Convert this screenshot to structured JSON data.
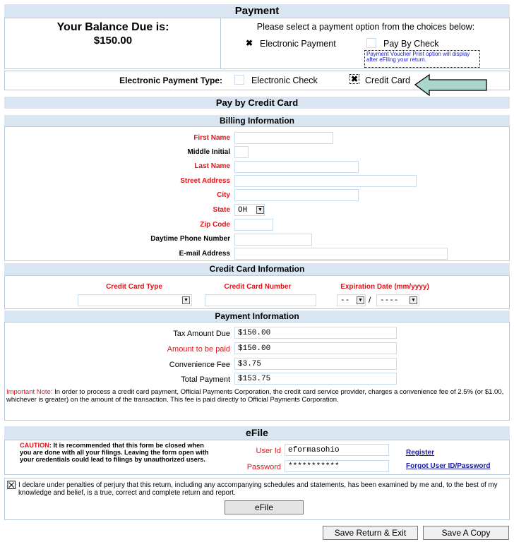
{
  "payment": {
    "header": "Payment",
    "balance_label": "Your Balance Due is:",
    "balance_amount": "$150.00",
    "select_prompt": "Please select a payment option from the choices below:",
    "option_electronic": "Electronic Payment",
    "option_check": "Pay By Check",
    "voucher_note": "Payment Voucher Print option will display after eFiling your return.",
    "type_label": "Electronic Payment Type:",
    "type_echeck": "Electronic Check",
    "type_credit": "Credit Card"
  },
  "credit": {
    "header": "Pay by Credit Card",
    "billing_header": "Billing Information",
    "fields": {
      "first_name": "First Name",
      "middle_initial": "Middle Initial",
      "last_name": "Last Name",
      "street": "Street Address",
      "city": "City",
      "state": "State",
      "state_value": "OH",
      "zip": "Zip Code",
      "phone": "Daytime Phone Number",
      "email": "E-mail Address"
    },
    "card_header": "Credit Card Information",
    "card_type": "Credit Card Type",
    "card_number": "Credit Card Number",
    "expiration": "Expiration Date (mm/yyyy)",
    "exp_month": "--",
    "exp_sep": "/",
    "exp_year": "----"
  },
  "payment_info": {
    "header": "Payment Information",
    "tax_due_label": "Tax Amount Due",
    "tax_due": "$150.00",
    "amount_paid_label": "Amount to be paid",
    "amount_paid": "$150.00",
    "fee_label": "Convenience Fee",
    "fee": "$3.75",
    "total_label": "Total Payment",
    "total": "$153.75",
    "note_prefix": "Important Note:",
    "note": " In order to process a credit card payment, Official Payments Corporation, the credit card service provider, charges a convenience fee of 2.5% (or $1.00, whichever is greater) on the amount of the transaction. This fee is paid directly to Official Payments Corporation."
  },
  "efile": {
    "header": "eFile",
    "caution_prefix": "CAUTION",
    "caution": ": It is recommended that this form be closed when you are done with all your filings. Leaving the form open with your credentials could lead to filings by unauthorized users.",
    "user_label": "User Id",
    "user_value": "eformasohio",
    "password_label": "Password",
    "password_value": "***********",
    "register": "Register",
    "forgot": "Forgot User ID/Password",
    "declaration": "I declare under penalties of perjury that this return, including any accompanying schedules and statements, has been examined by me and, to the best of my knowledge and belief, is a true, correct and complete return and report.",
    "efile_button": "eFile"
  },
  "actions": {
    "save_exit": "Save Return & Exit",
    "save_copy": "Save A Copy"
  },
  "icons": {
    "checked": "✖",
    "dropdown": "▼",
    "declaration_check": "☒"
  }
}
